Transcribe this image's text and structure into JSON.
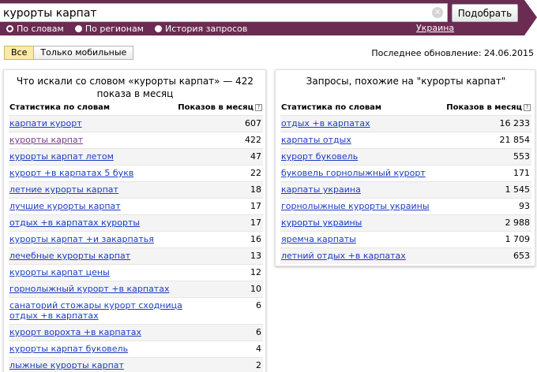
{
  "search": {
    "query": "курорты карпат",
    "clear_glyph": "×",
    "submit_label": "Подобрать"
  },
  "modes": [
    {
      "label": "По словам",
      "checked": true
    },
    {
      "label": "По регионам",
      "checked": false
    },
    {
      "label": "История запросов",
      "checked": false
    }
  ],
  "region": "Украина",
  "filters": {
    "all_label": "Все",
    "mobile_label": "Только мобильные"
  },
  "updated": "Последнее обновление: 24.06.2015",
  "left_panel": {
    "title": "Что искали со словом «курорты карпат» — 422 показа в месяц",
    "col_phrase": "Статистика по словам",
    "col_count": "Показов в месяц",
    "help_glyph": "?",
    "rows": [
      {
        "phrase": "карпати курорт",
        "count": "607"
      },
      {
        "phrase": "курорты карпат",
        "count": "422"
      },
      {
        "phrase": "курорты карпат летом",
        "count": "47"
      },
      {
        "phrase": "курорт +в карпатах 5 букв",
        "count": "22"
      },
      {
        "phrase": "летние курорты карпат",
        "count": "18"
      },
      {
        "phrase": "лучшие курорты карпат",
        "count": "17"
      },
      {
        "phrase": "отдых +в карпатах курорты",
        "count": "17"
      },
      {
        "phrase": "курорты карпат +и закарпатья",
        "count": "16"
      },
      {
        "phrase": "лечебные курорты карпат",
        "count": "13"
      },
      {
        "phrase": "курорты карпат цены",
        "count": "12"
      },
      {
        "phrase": "горнолыжный курорт +в карпатах",
        "count": "10"
      },
      {
        "phrase": "санаторий стожары курорт сходница отдых +в карпатах",
        "count": "6"
      },
      {
        "phrase": "курорт ворохта +в карпатах",
        "count": "6"
      },
      {
        "phrase": "курорты карпат буковель",
        "count": "4"
      },
      {
        "phrase": "лыжные курорты карпат",
        "count": "2"
      }
    ]
  },
  "right_panel": {
    "title": "Запросы, похожие на \"курорты карпат\"",
    "col_phrase": "Статистика по словам",
    "col_count": "Показов в месяц",
    "help_glyph": "?",
    "rows": [
      {
        "phrase": "отдых +в карпатах",
        "count": "16 233"
      },
      {
        "phrase": "карпаты отдых",
        "count": "21 854"
      },
      {
        "phrase": "курорт буковель",
        "count": "553"
      },
      {
        "phrase": "буковель горнолыжный курорт",
        "count": "171"
      },
      {
        "phrase": "карпаты украина",
        "count": "1 545"
      },
      {
        "phrase": "горнолыжные курорты украины",
        "count": "93"
      },
      {
        "phrase": "курорты украины",
        "count": "2 988"
      },
      {
        "phrase": "яремча карпаты",
        "count": "1 709"
      },
      {
        "phrase": "летний отдых +в карпатах",
        "count": "653"
      }
    ]
  },
  "colors": {
    "header": "#6c2b52",
    "link": "#1a3dc1",
    "visited_link": "#7b3a8f",
    "active_tab": "#fbe9a6"
  }
}
